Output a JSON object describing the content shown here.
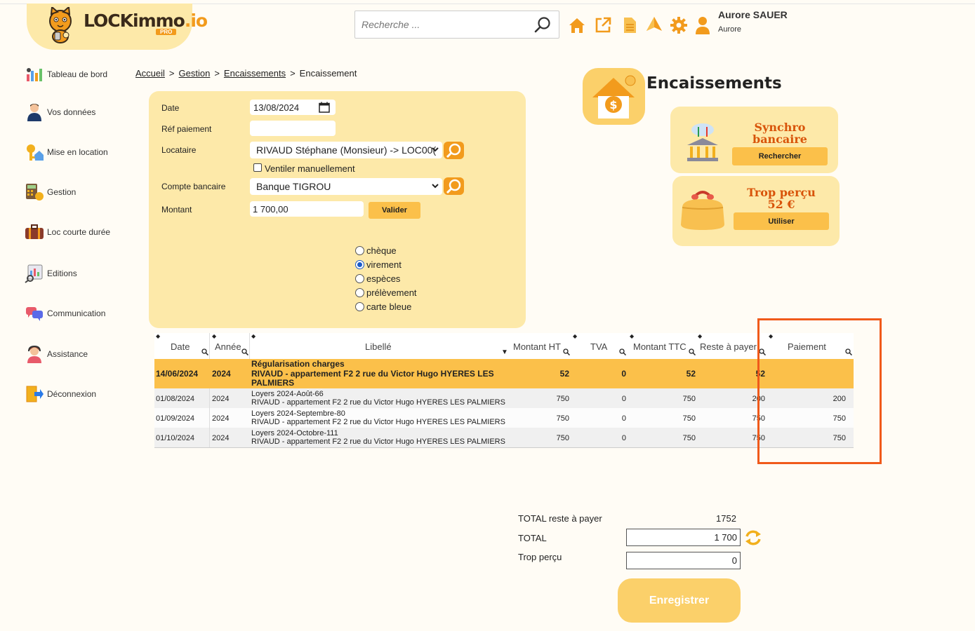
{
  "brand": {
    "name": "LOCKimmo",
    "suffix": ".io",
    "badge": "PRO"
  },
  "search": {
    "placeholder": "Recherche ..."
  },
  "user": {
    "name": "Aurore SAUER",
    "sub": "Aurore"
  },
  "sidebar": {
    "items": [
      {
        "label": "Tableau de bord"
      },
      {
        "label": "Vos données"
      },
      {
        "label": "Mise en location"
      },
      {
        "label": "Gestion"
      },
      {
        "label": "Loc courte durée"
      },
      {
        "label": "Editions"
      },
      {
        "label": "Communication"
      },
      {
        "label": "Assistance"
      },
      {
        "label": "Déconnexion"
      }
    ]
  },
  "breadcrumb": {
    "home": "Accueil",
    "gestion": "Gestion",
    "encaissements": "Encaissements",
    "current": "Encaissement"
  },
  "form": {
    "date_label": "Date",
    "date_value": "13/08/2024",
    "ref_label": "Réf paiement",
    "ref_value": "",
    "locataire_label": "Locataire",
    "locataire_value": "RIVAUD Stéphane (Monsieur) -> LOC00(",
    "ventiler_label": "Ventiler manuellement",
    "compte_label": "Compte bancaire",
    "compte_value": "Banque TIGROU",
    "montant_label": "Montant",
    "montant_value": "1 700,00",
    "valider_label": "Valider",
    "payment_types": [
      {
        "label": "chèque",
        "selected": false
      },
      {
        "label": "virement",
        "selected": true
      },
      {
        "label": "espèces",
        "selected": false
      },
      {
        "label": "prélèvement",
        "selected": false
      },
      {
        "label": "carte bleue",
        "selected": false
      }
    ]
  },
  "right": {
    "title": "Encaissements",
    "synchro_title": "Synchro bancaire",
    "synchro_line1": "Synchro",
    "synchro_line2": "bancaire",
    "synchro_button": "Rechercher",
    "trop_line1": "Trop perçu",
    "trop_line2": "52 €",
    "trop_button": "Utiliser"
  },
  "table": {
    "headers": [
      "Date",
      "Année",
      "Libellé",
      "Montant HT",
      "TVA",
      "Montant TTC",
      "Reste à payer",
      "Paiement"
    ],
    "rows": [
      {
        "date": "14/06/2024",
        "annee": "2024",
        "lib1": "Régularisation charges",
        "lib2": "RIVAUD - appartement F2 2 rue du Victor Hugo HYERES LES",
        "lib3": "PALMIERS",
        "ht": "52",
        "tva": "0",
        "ttc": "52",
        "reste": "52",
        "paiement": ""
      },
      {
        "date": "01/08/2024",
        "annee": "2024",
        "lib1": "Loyers 2024-Août-66",
        "lib2": "RIVAUD - appartement F2 2 rue du Victor Hugo HYERES LES PALMIERS",
        "lib3": "",
        "ht": "750",
        "tva": "0",
        "ttc": "750",
        "reste": "200",
        "paiement": "200"
      },
      {
        "date": "01/09/2024",
        "annee": "2024",
        "lib1": "Loyers 2024-Septembre-80",
        "lib2": "RIVAUD - appartement F2 2 rue du Victor Hugo HYERES LES PALMIERS",
        "lib3": "",
        "ht": "750",
        "tva": "0",
        "ttc": "750",
        "reste": "750",
        "paiement": "750"
      },
      {
        "date": "01/10/2024",
        "annee": "2024",
        "lib1": "Loyers 2024-Octobre-111",
        "lib2": "RIVAUD - appartement F2 2 rue du Victor Hugo HYERES LES PALMIERS",
        "lib3": "",
        "ht": "750",
        "tva": "0",
        "ttc": "750",
        "reste": "750",
        "paiement": "750"
      }
    ]
  },
  "totals": {
    "reste_label": "TOTAL reste à payer",
    "reste_value": "1752",
    "total_label": "TOTAL",
    "total_value": "1 700",
    "trop_label": "Trop perçu",
    "trop_value": "0",
    "save_label": "Enregistrer"
  },
  "colors": {
    "accent": "#f29b1d",
    "panel": "#fde9a9",
    "highlight": "#fbc04a",
    "annotation": "#f05a1a"
  }
}
